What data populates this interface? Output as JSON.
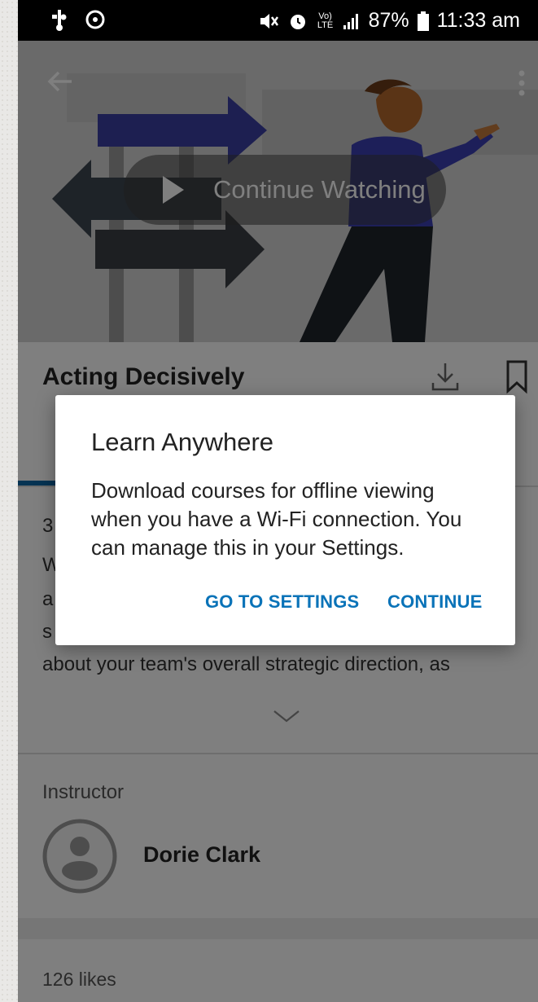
{
  "status_bar": {
    "signal_label": "Vo) LTE",
    "battery_percent": "87%",
    "time": "11:33 am"
  },
  "hero": {
    "continue_label": "Continue Watching"
  },
  "course": {
    "title": "Acting Decisively",
    "description_lines": [
      "3",
      "W",
      "a",
      "s",
      "about your team's overall strategic direction, as"
    ]
  },
  "instructor": {
    "heading": "Instructor",
    "name": "Dorie Clark"
  },
  "likes": {
    "count_label": "126 likes"
  },
  "dialog": {
    "title": "Learn Anywhere",
    "body": "Download courses for offline viewing when you have a Wi-Fi connection. You can manage this in your Settings.",
    "go_to_settings_label": "GO TO SETTINGS",
    "continue_label": "CONTINUE"
  },
  "colors": {
    "accent": "#0a73b8",
    "tab_indicator": "#0a66a6"
  }
}
